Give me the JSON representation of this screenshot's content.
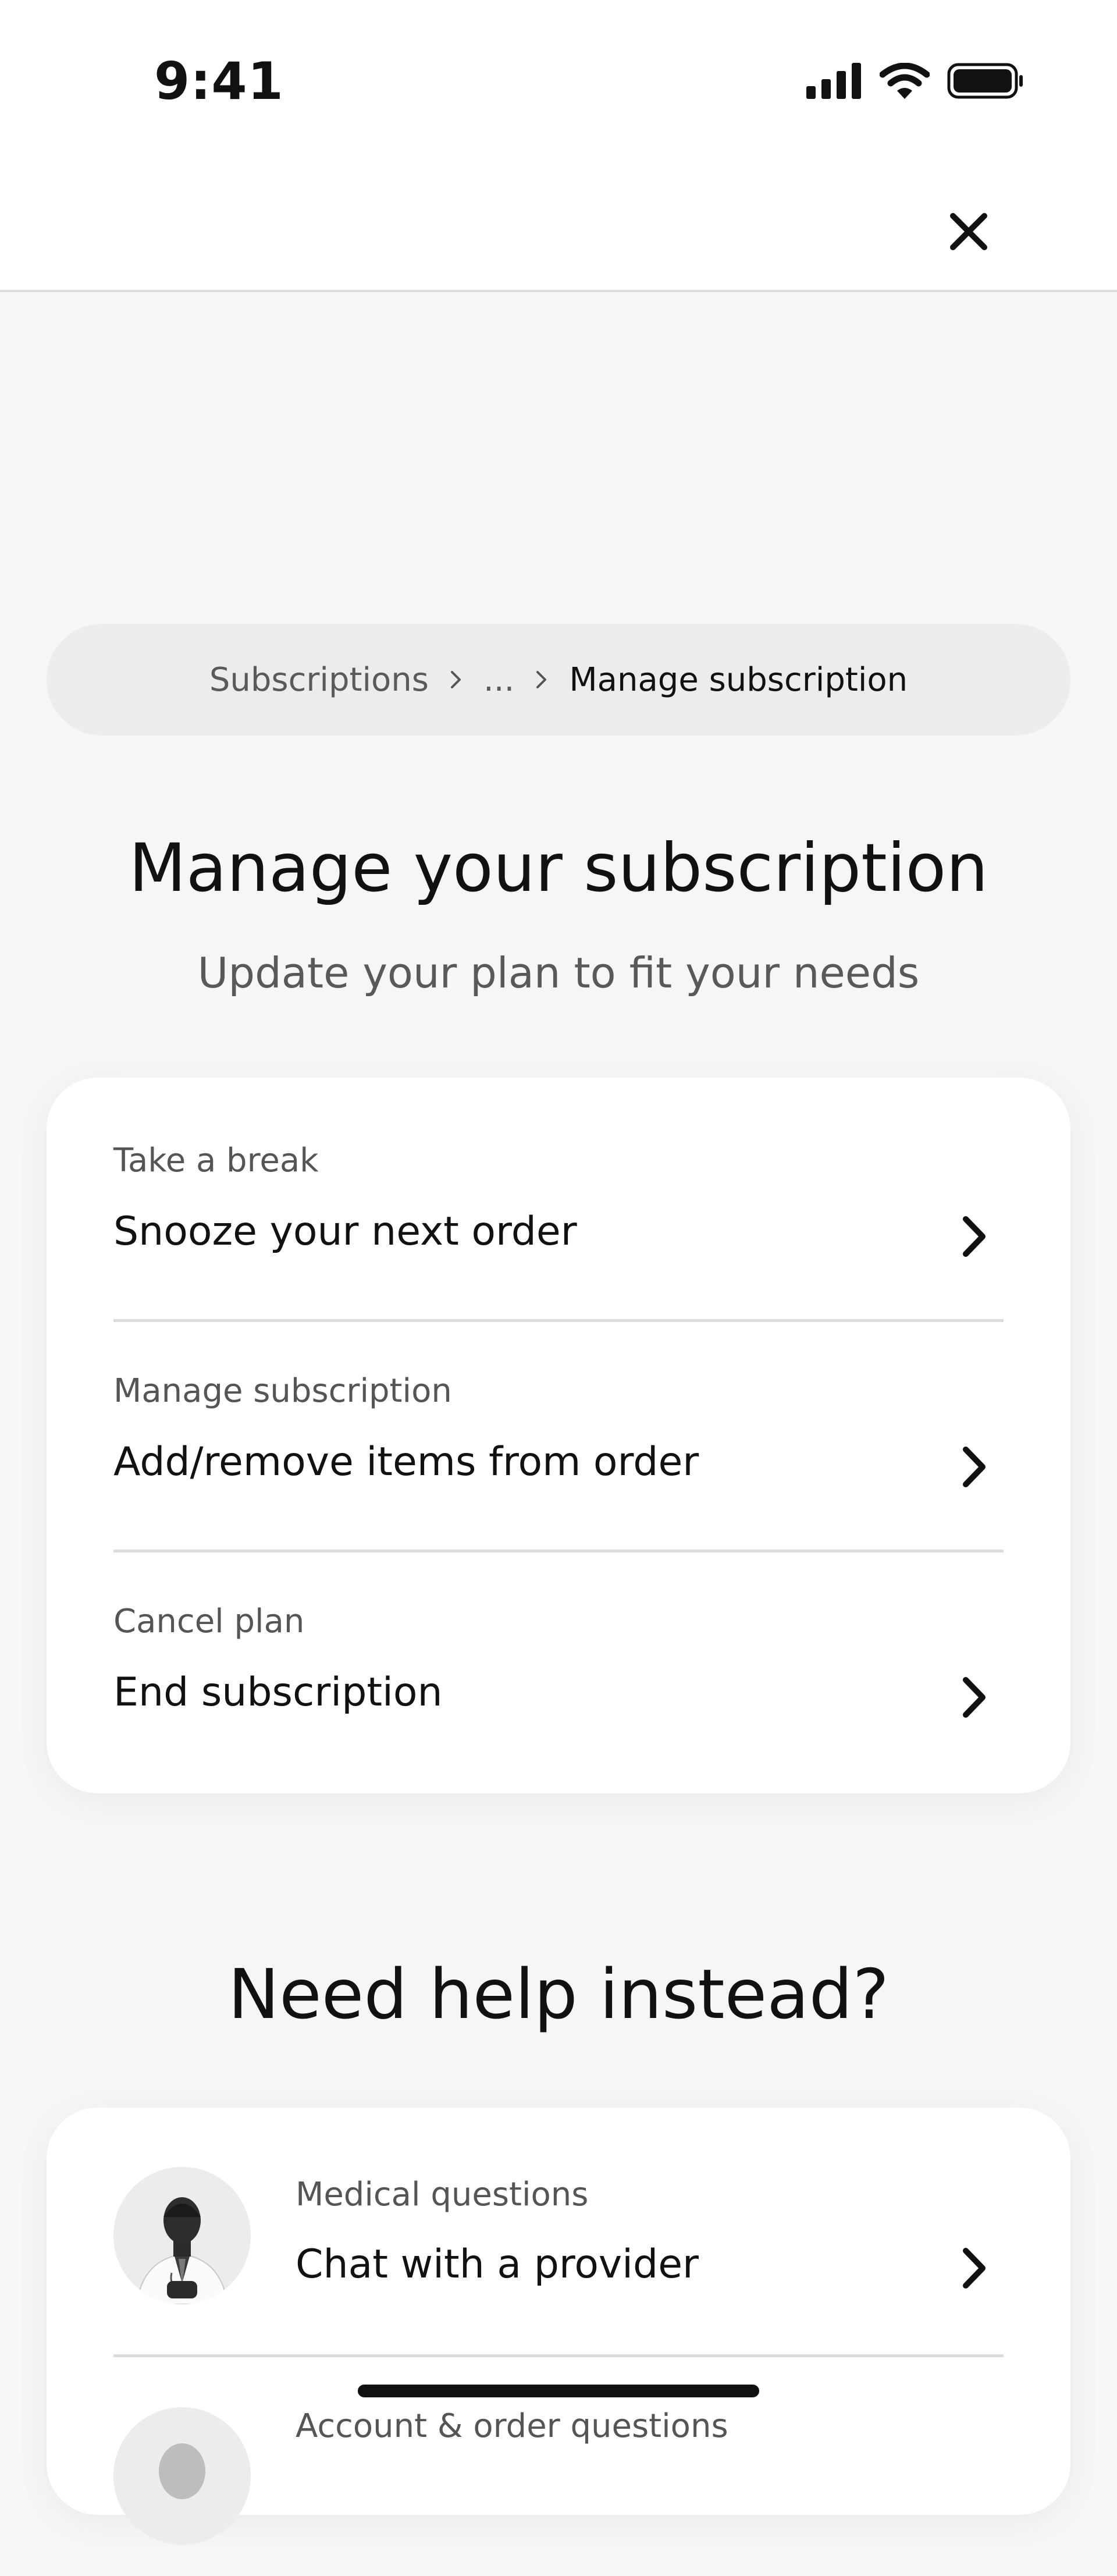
{
  "status_bar": {
    "time": "9:41"
  },
  "header": {
    "close_icon": "close-icon"
  },
  "breadcrumb": {
    "items": [
      "Subscriptions",
      "...",
      "Manage subscription"
    ],
    "separator_icon": "chevron-right-icon"
  },
  "page": {
    "title": "Manage your subscription",
    "subtitle": "Update your plan to fit your needs"
  },
  "options": [
    {
      "kicker": "Take a break",
      "title": "Snooze your next order"
    },
    {
      "kicker": "Manage subscription",
      "title": "Add/remove items from order"
    },
    {
      "kicker": "Cancel plan",
      "title": "End subscription"
    }
  ],
  "help": {
    "title": "Need help instead?",
    "items": [
      {
        "kicker": "Medical questions",
        "title": "Chat with a provider",
        "avatar": "doctor-photo"
      },
      {
        "kicker": "Account & order questions",
        "title": "",
        "avatar": "support-photo"
      }
    ]
  },
  "colors": {
    "background": "#f6f6f6",
    "card": "#ffffff",
    "text": "#111111",
    "muted": "#595959"
  }
}
